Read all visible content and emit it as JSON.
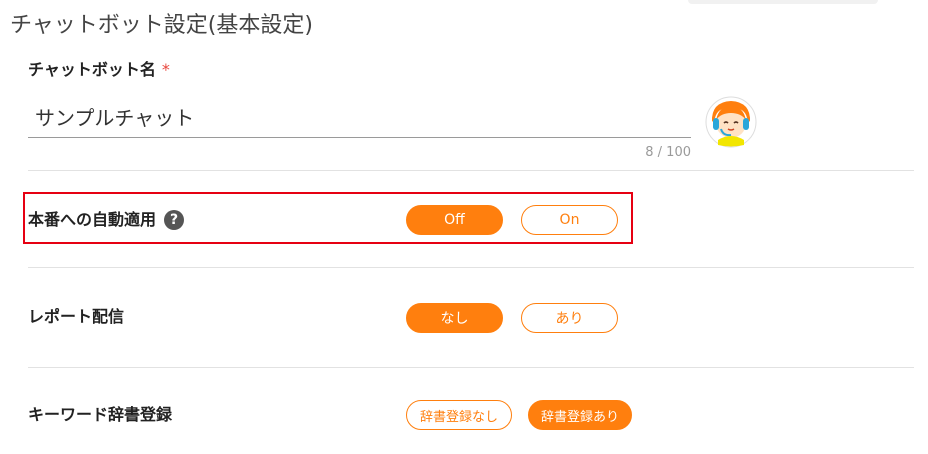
{
  "page": {
    "title": "チャットボット設定(基本設定)"
  },
  "chatbot_name": {
    "label": "チャットボット名",
    "required_mark": "*",
    "value": "サンプルチャット",
    "counter": "8 / 100"
  },
  "auto_apply": {
    "label": "本番への自動適用",
    "help_icon": "question-circle-icon",
    "options": [
      "Off",
      "On"
    ],
    "selected": "Off"
  },
  "report": {
    "label": "レポート配信",
    "options": [
      "なし",
      "あり"
    ],
    "selected": "なし"
  },
  "keyword_dictionary": {
    "label": "キーワード辞書登録",
    "options": [
      "辞書登録なし",
      "辞書登録あり"
    ],
    "selected": "辞書登録あり"
  },
  "colors": {
    "accent": "#ff7f0e",
    "highlight": "#e60012",
    "required": "#e8453c"
  }
}
